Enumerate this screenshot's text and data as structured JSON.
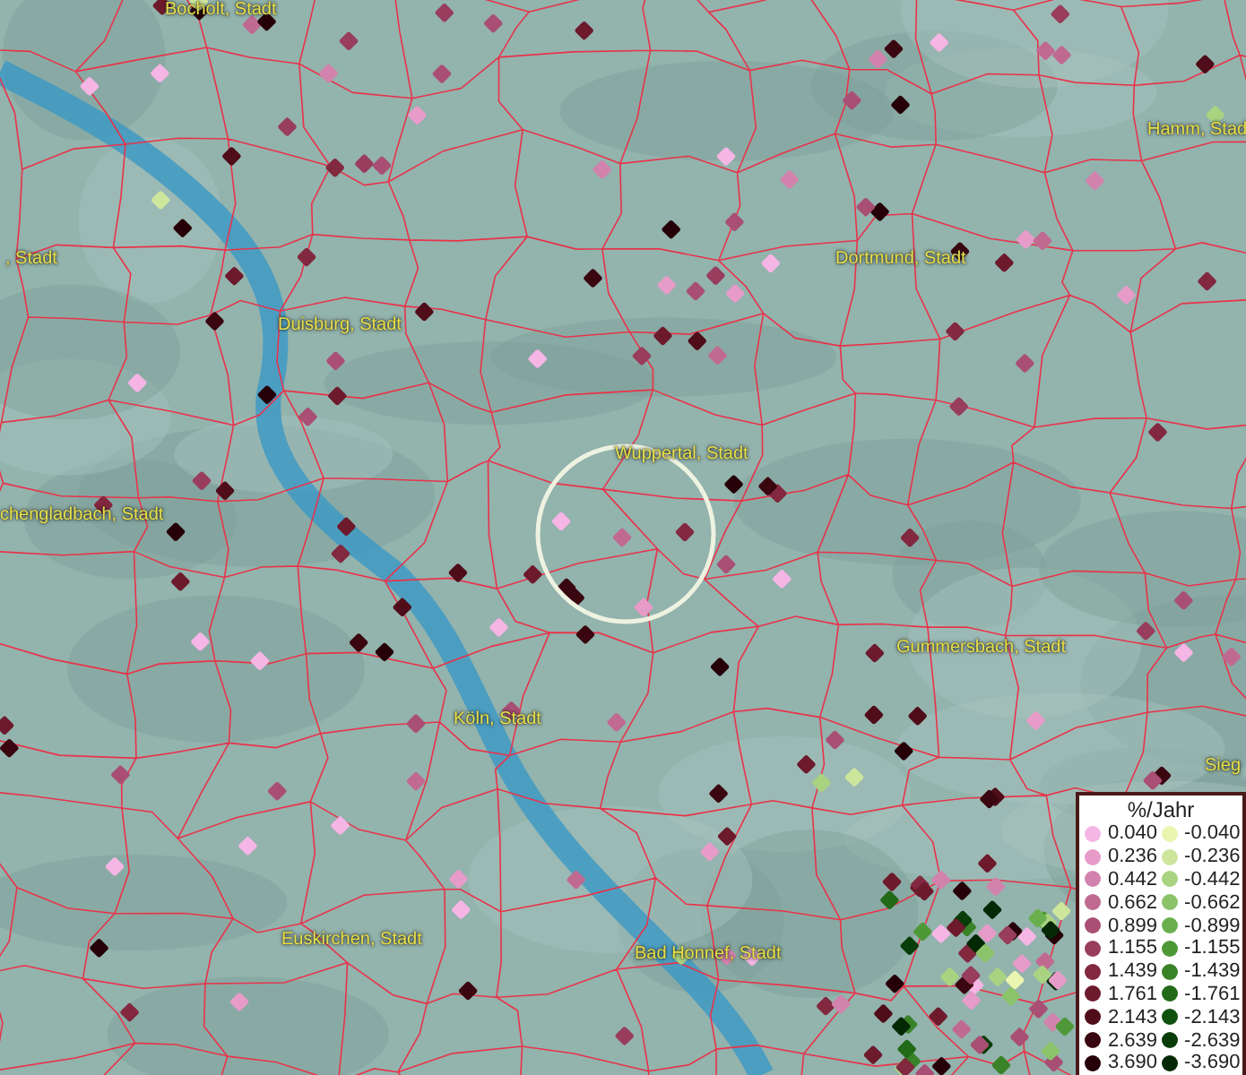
{
  "map": {
    "places": [
      {
        "name": "Bocholt, Stadt"
      },
      {
        "name": ", Stadt"
      },
      {
        "name": "Duisburg, Stadt"
      },
      {
        "name": "Dortmund, Stadt"
      },
      {
        "name": "Hamm, Stad"
      },
      {
        "name": "Wuppertal, Stadt"
      },
      {
        "name": "chengladbach, Stadt"
      },
      {
        "name": "Gummersbach, Stadt"
      },
      {
        "name": "Köln, Stadt"
      },
      {
        "name": "Sieg"
      },
      {
        "name": "Euskirchen, Stadt"
      },
      {
        "name": "Bad Honnef, Stadt"
      }
    ]
  },
  "legend": {
    "title": "%/Jahr",
    "positive": [
      {
        "value": "0.040",
        "color": "#f5b5e5"
      },
      {
        "value": "0.236",
        "color": "#e79bc9"
      },
      {
        "value": "0.442",
        "color": "#d283ad"
      },
      {
        "value": "0.662",
        "color": "#c06a92"
      },
      {
        "value": "0.899",
        "color": "#a94f73"
      },
      {
        "value": "1.155",
        "color": "#983d5c"
      },
      {
        "value": "1.439",
        "color": "#82283f"
      },
      {
        "value": "1.761",
        "color": "#6d1a2c"
      },
      {
        "value": "2.143",
        "color": "#4f0c19"
      },
      {
        "value": "2.639",
        "color": "#3a0610"
      },
      {
        "value": "3.690",
        "color": "#250008"
      }
    ],
    "negative": [
      {
        "value": "-0.040",
        "color": "#eaf5b0"
      },
      {
        "value": "-0.236",
        "color": "#cde69c"
      },
      {
        "value": "-0.442",
        "color": "#a9d381"
      },
      {
        "value": "-0.662",
        "color": "#8bc36a"
      },
      {
        "value": "-0.899",
        "color": "#6aaf4e"
      },
      {
        "value": "-1.155",
        "color": "#4e9838"
      },
      {
        "value": "-1.439",
        "color": "#3a8228"
      },
      {
        "value": "-1.761",
        "color": "#226a18"
      },
      {
        "value": "-2.143",
        "color": "#0f5210"
      },
      {
        "value": "-2.639",
        "color": "#083d0a"
      },
      {
        "value": "-3.690",
        "color": "#032803"
      }
    ]
  }
}
